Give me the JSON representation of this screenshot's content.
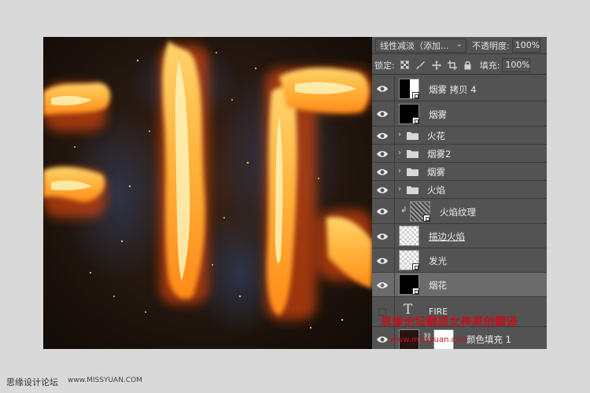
{
  "panel": {
    "blend_mode": "线性减淡（添加...",
    "opacity_label": "不透明度:",
    "opacity_value": "100%",
    "lock_label": "锁定:",
    "fill_label": "填充:",
    "fill_value": "100%"
  },
  "layers": [
    {
      "name": "烟雾 拷贝 4",
      "kind": "smart",
      "thumb": "black-white"
    },
    {
      "name": "烟雾",
      "kind": "smart",
      "thumb": "black"
    },
    {
      "name": "火花",
      "kind": "group"
    },
    {
      "name": "烟雾2",
      "kind": "group"
    },
    {
      "name": "烟雾",
      "kind": "group"
    },
    {
      "name": "火焰",
      "kind": "group"
    },
    {
      "name": "火焰纹理",
      "kind": "clipped-smart",
      "thumb": "noise"
    },
    {
      "name": "描边火焰",
      "kind": "pixel",
      "thumb": "transparent"
    },
    {
      "name": "发光",
      "kind": "smart",
      "thumb": "transparent"
    },
    {
      "name": "烟花",
      "kind": "smart",
      "thumb": "black",
      "selected": true
    },
    {
      "name": "FIRE",
      "kind": "text",
      "hidden": true
    },
    {
      "name": "颜色填充 1",
      "kind": "fill"
    }
  ],
  "watermark": {
    "text": "思缘论坛翻恶女神原创翻译",
    "url": "www.missyuan.com"
  },
  "footer": {
    "brand": "思缘设计论坛",
    "url": "www.MISSYUAN.COM"
  },
  "colors": {
    "panel_bg": "#535353",
    "selected_row": "#6b6b6b",
    "canvas_bg": "#1c130f",
    "flame_core": "#ffe08a",
    "flame_mid": "#ff9a1f",
    "flame_outer": "#c9420a",
    "watermark_red": "#c1121f"
  },
  "icons": [
    "eye-icon",
    "folder-icon",
    "chevron-right-icon",
    "lock-transparency-icon",
    "lock-paint-icon",
    "lock-move-icon",
    "lock-artboard-icon",
    "lock-all-icon",
    "link-icon",
    "text-type-icon"
  ]
}
